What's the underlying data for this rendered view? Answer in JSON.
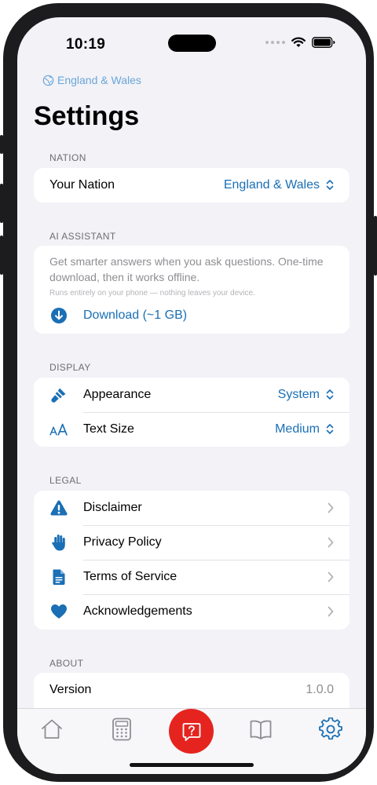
{
  "status_bar": {
    "time": "10:19"
  },
  "header": {
    "nation_badge": "England & Wales",
    "title": "Settings"
  },
  "sections": {
    "nation": {
      "label": "NATION",
      "row": {
        "label": "Your Nation",
        "value": "England & Wales"
      }
    },
    "ai": {
      "label": "AI ASSISTANT",
      "description": "Get smarter answers when you ask questions. One-time download, then it works offline.",
      "note": "Runs entirely on your phone — nothing leaves your device.",
      "download_label": "Download (~1 GB)"
    },
    "display": {
      "label": "DISPLAY",
      "appearance": {
        "label": "Appearance",
        "value": "System"
      },
      "text_size": {
        "label": "Text Size",
        "value": "Medium"
      }
    },
    "legal": {
      "label": "LEGAL",
      "items": [
        {
          "label": "Disclaimer",
          "icon": "warning-icon"
        },
        {
          "label": "Privacy Policy",
          "icon": "hand-icon"
        },
        {
          "label": "Terms of Service",
          "icon": "document-icon"
        },
        {
          "label": "Acknowledgements",
          "icon": "heart-icon"
        }
      ]
    },
    "about": {
      "label": "ABOUT",
      "version": {
        "label": "Version",
        "value": "1.0.0"
      }
    }
  },
  "tabbar": {
    "tabs": [
      "home-icon",
      "calculator-icon",
      "ask-question-icon",
      "book-icon",
      "gear-icon"
    ],
    "active": "gear-icon"
  },
  "colors": {
    "accent": "#1a6fb5",
    "ask_button": "#e5241f",
    "background": "#f2f2f7"
  }
}
